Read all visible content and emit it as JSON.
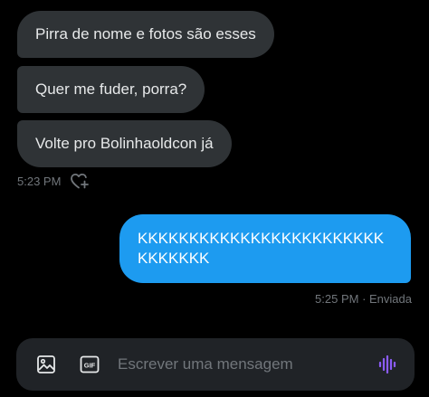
{
  "conversation": {
    "received": [
      {
        "text": "Pirra de nome e fotos são esses"
      },
      {
        "text": "Quer me fuder, porra?"
      },
      {
        "text": "Volte pro Bolinhaoldcon já"
      }
    ],
    "received_time": "5:23 PM",
    "sent": {
      "text": "KKKKKKKKKKKKKKKKKKKKKKKKKKKKKKK",
      "time": "5:25 PM · Enviada"
    }
  },
  "composer": {
    "placeholder": "Escrever uma mensagem",
    "value": "",
    "gif_label": "GIF"
  },
  "icons": {
    "react": "heart-plus-icon",
    "media": "image-icon",
    "gif": "gif-icon",
    "voice": "voice-waveform-icon"
  },
  "colors": {
    "background": "#000000",
    "received_bubble": "#2f3336",
    "sent_bubble": "#1d9bf0",
    "muted_text": "#71767b",
    "voice_accent": "#8b5cf6",
    "composer_bg": "#202327"
  }
}
